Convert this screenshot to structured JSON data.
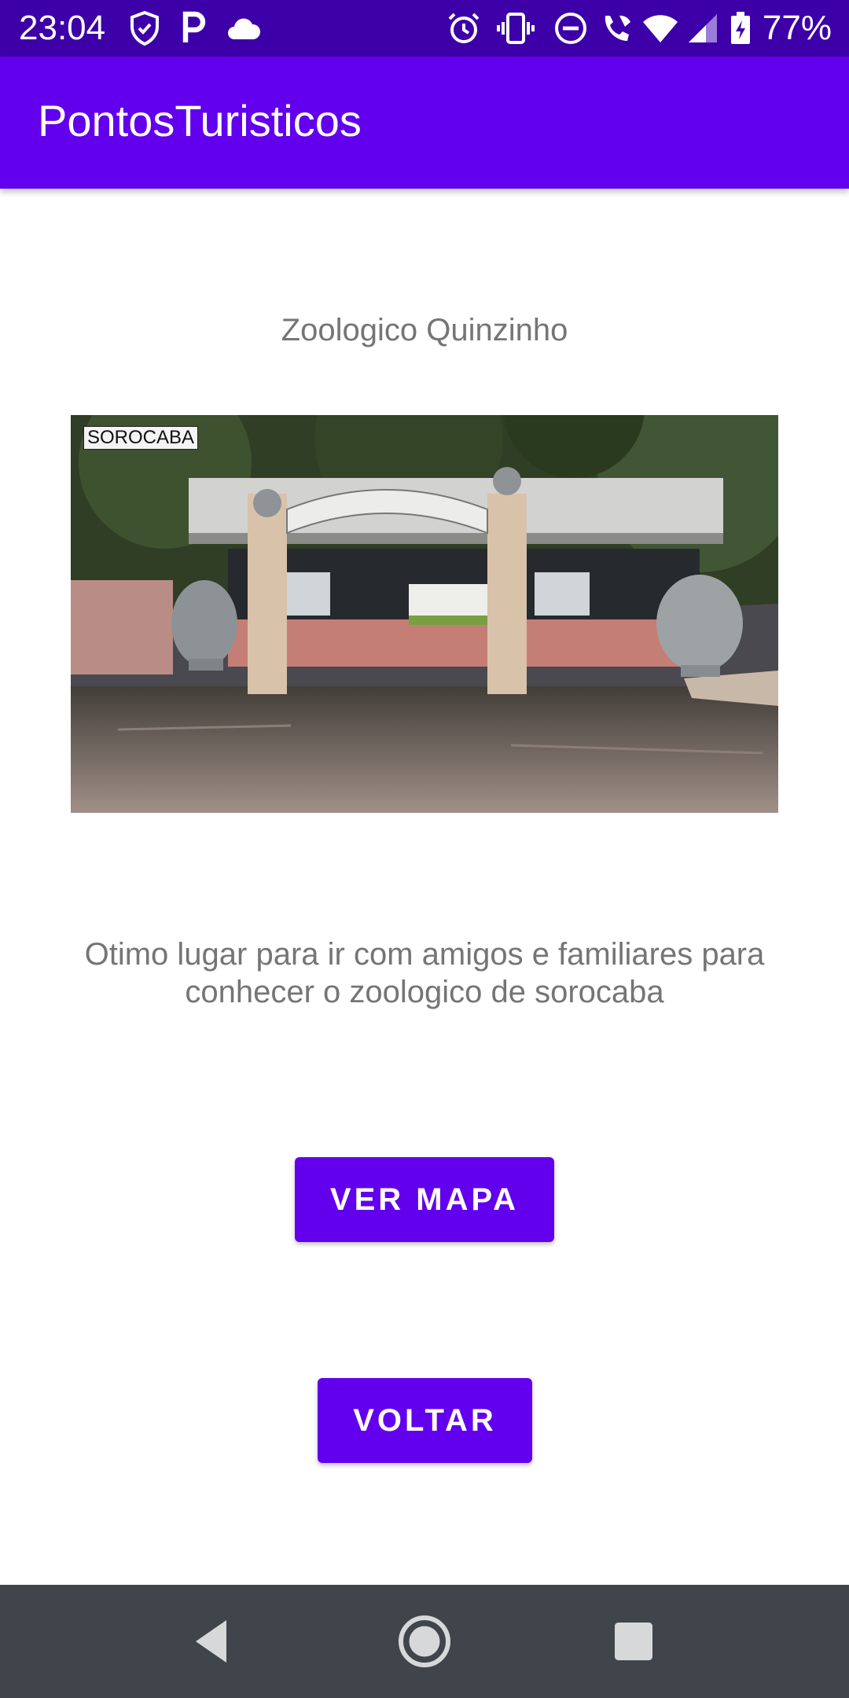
{
  "status_bar": {
    "time": "23:04",
    "battery": "77%",
    "left_icons": [
      "shield-check-icon",
      "parking-p-icon",
      "cloud-icon"
    ],
    "right_icons": [
      "alarm-icon",
      "vibrate-icon",
      "do-not-disturb-icon",
      "wifi-calling-icon",
      "wifi-icon",
      "cell-signal-icon",
      "battery-charging-icon"
    ]
  },
  "app_bar": {
    "title": "PontosTuristicos"
  },
  "place": {
    "title": "Zoologico Quinzinho",
    "photo_caption": "SOROCABA",
    "description": "Otimo lugar para ir com amigos e familiares para conhecer o zoologico de sorocaba"
  },
  "buttons": {
    "map_label": "VER MAPA",
    "back_label": "VOLTAR"
  },
  "navigation": {
    "icons": [
      "back-triangle-icon",
      "home-circle-icon",
      "recents-square-icon"
    ]
  },
  "colors": {
    "primary": "#6200ee",
    "primary_dark": "#3d00a8",
    "text_secondary": "#757575",
    "nav_bar": "#3f454b"
  }
}
